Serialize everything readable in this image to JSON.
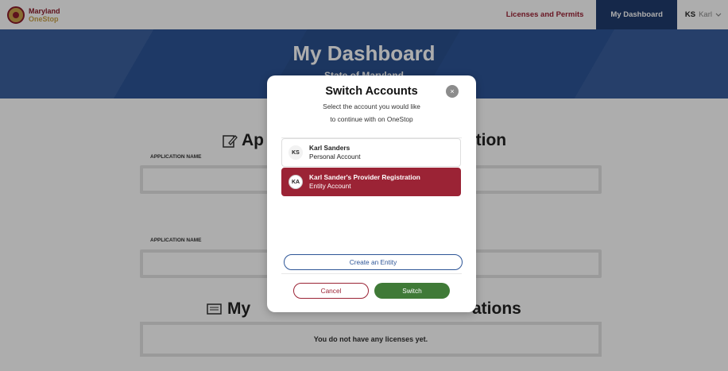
{
  "header": {
    "logo_line1": "Maryland",
    "logo_line2": "OneStop",
    "nav_licenses": "Licenses and Permits",
    "nav_dashboard": "My Dashboard",
    "user_initials": "KS",
    "user_name": "Karl"
  },
  "hero": {
    "title": "My Dashboard",
    "subtitle": "State of Maryland"
  },
  "sections": {
    "applications_title_left": "Ap",
    "applications_title_right": "ction",
    "column_label_1": "APPLICATION NAME",
    "column_label_2": "APPLICATION NAME",
    "licenses_title_left": "My ",
    "licenses_title_right": "ations",
    "empty_licenses": "You do not have any licenses yet."
  },
  "modal": {
    "title": "Switch Accounts",
    "description_line1": "Select the account you would like",
    "description_line2": "to continue with on OneStop",
    "close_symbol": "×",
    "accounts": [
      {
        "initials": "KS",
        "name": "Karl Sanders",
        "type": "Personal Account",
        "selected": false
      },
      {
        "initials": "KA",
        "name": "Karl Sander's Provider Registration",
        "type": "Entity Account",
        "selected": true
      }
    ],
    "create_label": "Create an Entity",
    "cancel_label": "Cancel",
    "switch_label": "Switch"
  },
  "colors": {
    "brand_red": "#9b2335",
    "brand_blue": "#2d5597",
    "switch_green": "#3f7a37"
  }
}
